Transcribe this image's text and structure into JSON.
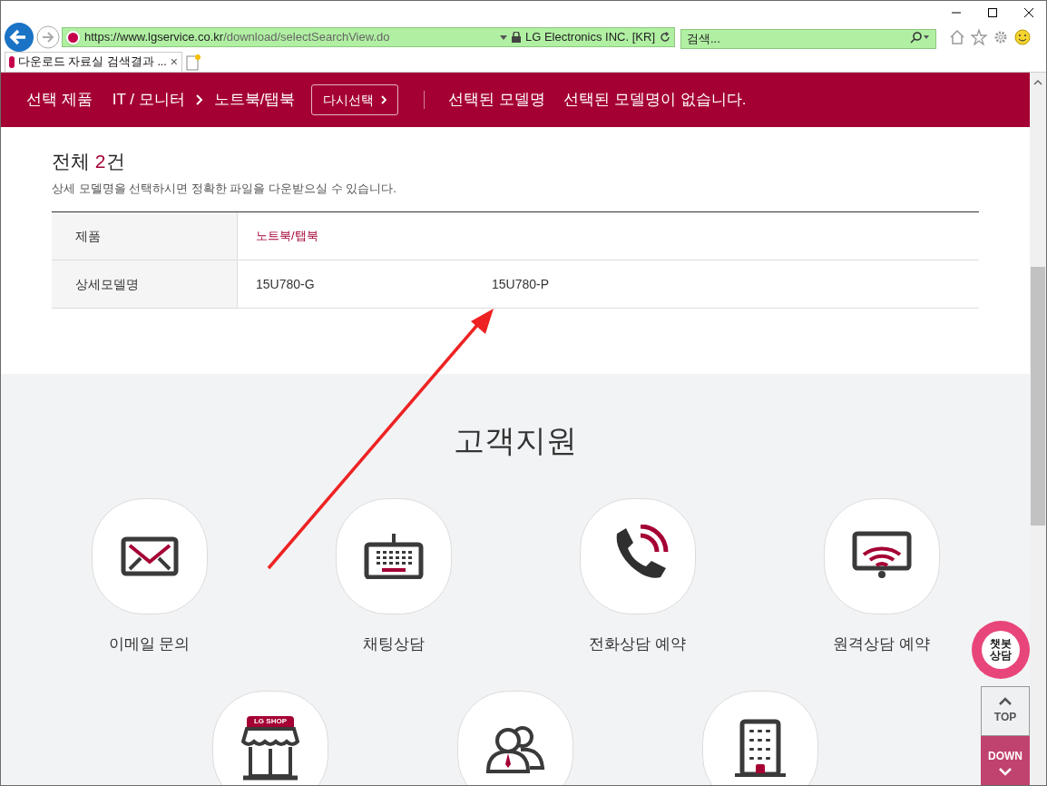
{
  "browser": {
    "url_host": "https://www.lgservice.co.kr",
    "url_path": "/download/selectSearchView.do",
    "cert": "LG Electronics INC. [KR]",
    "search_placeholder": "검색...",
    "tab_title": "다운로드 자료실 검색결과 ...",
    "tab_close": "×"
  },
  "banner": {
    "label": "선택 제품",
    "category": "IT / 모니터",
    "product": "노트북/탭북",
    "reselect": "다시선택",
    "model_label": "선택된 모델명",
    "model_value": "선택된 모델명이 없습니다."
  },
  "results": {
    "before": "전체 ",
    "count": "2",
    "after": "건",
    "hint": "상세 모델명을 선택하시면 정확한 파일을 다운받으실 수 있습니다."
  },
  "table": {
    "rows": [
      {
        "kind": "product",
        "header": "제품",
        "values": [
          "노트북/탭북"
        ]
      },
      {
        "kind": "models",
        "header": "상세모델명",
        "values": [
          "15U780-G",
          "15U780-P"
        ]
      }
    ]
  },
  "support": {
    "title": "고객지원",
    "items": [
      {
        "kind": "mail",
        "label": "이메일 문의"
      },
      {
        "kind": "keyboard",
        "label": "채팅상담"
      },
      {
        "kind": "phone",
        "label": "전화상담 예약"
      },
      {
        "kind": "remote",
        "label": "원격상담 예약"
      },
      {
        "kind": "shop",
        "sign": "LG SHOP"
      },
      {
        "kind": "people"
      },
      {
        "kind": "building"
      }
    ]
  },
  "floating": {
    "chatbot": [
      "챗봇",
      "상담"
    ],
    "top": "TOP",
    "down": "DOWN"
  }
}
